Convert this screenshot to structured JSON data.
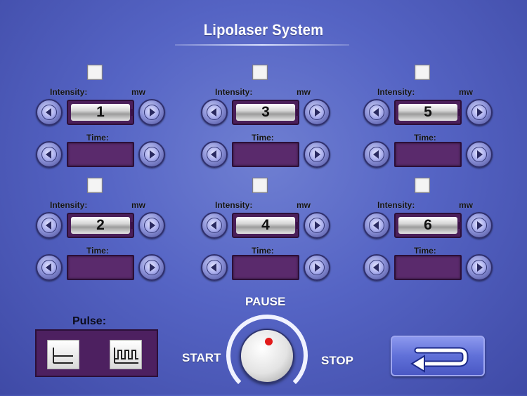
{
  "app": {
    "title": "Lipolaser System"
  },
  "labels": {
    "intensity": "Intensity:",
    "unit": "mw",
    "time": "Time:"
  },
  "channels": [
    {
      "id": "1",
      "time": ""
    },
    {
      "id": "3",
      "time": ""
    },
    {
      "id": "5",
      "time": ""
    },
    {
      "id": "2",
      "time": ""
    },
    {
      "id": "4",
      "time": ""
    },
    {
      "id": "6",
      "time": ""
    }
  ],
  "pulse": {
    "label": "Pulse:"
  },
  "controls": {
    "pause": "PAUSE",
    "start": "START",
    "stop": "STOP"
  },
  "colors": {
    "background": "#5564c4",
    "panel": "#4b1f5a",
    "indicator": "#e21b1b"
  }
}
